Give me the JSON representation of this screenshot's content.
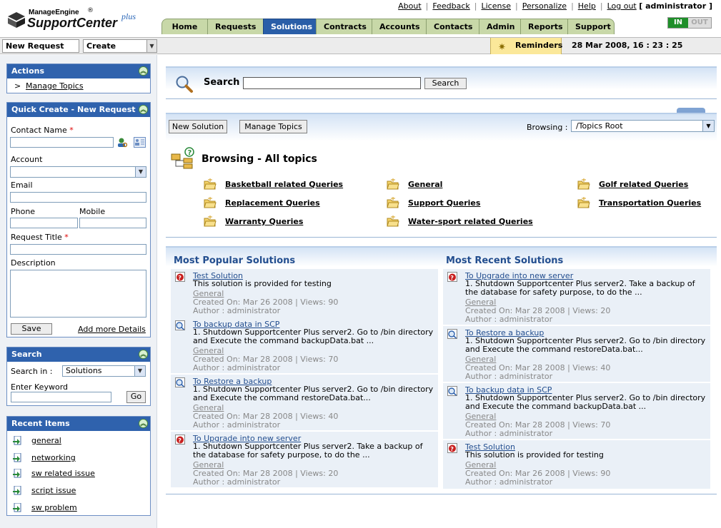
{
  "header": {
    "brand_top": "ManageEngine",
    "brand_reg": "®",
    "brand_name": "SupportCenter",
    "brand_plus": "plus",
    "links": [
      "About",
      "Feedback",
      "License",
      "Personalize",
      "Help",
      "Log out"
    ],
    "user": "[ administrator ]",
    "tabs": [
      "Home",
      "Requests",
      "Solutions",
      "Contracts",
      "Accounts",
      "Contacts",
      "Admin",
      "Reports",
      "Support"
    ],
    "active_tab": "Solutions",
    "in_label": "IN",
    "out_label": "OUT"
  },
  "toolbar": {
    "new_request": "New Request",
    "create": "Create",
    "reminders": "Reminders",
    "datetime": "28 Mar 2008, 16 : 23 : 25"
  },
  "sidebar": {
    "actions": {
      "title": "Actions",
      "bullet": ">",
      "manage_topics": "Manage Topics"
    },
    "quick_create": {
      "title": "Quick Create - New Request",
      "contact_name": "Contact Name",
      "required_mark": "*",
      "account": "Account",
      "email": "Email",
      "phone": "Phone",
      "mobile": "Mobile",
      "request_title": "Request Title",
      "description": "Description",
      "save": "Save",
      "add_more": "Add more Details"
    },
    "search": {
      "title": "Search",
      "search_in": "Search in :",
      "search_in_value": "Solutions",
      "enter_keyword": "Enter Keyword",
      "go": "Go"
    },
    "recent": {
      "title": "Recent Items",
      "items": [
        "general",
        "networking",
        "sw related issue",
        "script issue",
        "sw problem"
      ]
    }
  },
  "main": {
    "search_title": "Search",
    "search_button": "Search",
    "new_solution": "New Solution",
    "manage_topics": "Manage Topics",
    "browsing_label": "Browsing :",
    "browsing_value": "/Topics Root",
    "browse_title": "Browsing - All topics",
    "topics": [
      "Basketball related Queries",
      "General",
      "Golf related Queries",
      "Replacement Queries",
      "Support Queries",
      "Transportation Queries",
      "Warranty Queries",
      "Water-sport related Queries"
    ],
    "popular_title": "Most Popular Solutions",
    "recent_title": "Most Recent Solutions",
    "popular": [
      {
        "title": "Test Solution",
        "desc": "This solution is provided for testing",
        "cat": "General",
        "meta": "Created On: Mar 26 2008   |  Views: 90",
        "author": "Author : administrator",
        "icon": "red"
      },
      {
        "title": "To backup data in SCP",
        "desc": "1. Shutdown Supportcenter Plus server2. Go to /bin directory and Execute the command backupData.bat ...",
        "cat": "General",
        "meta": "Created On: Mar 28 2008   |  Views: 70",
        "author": "Author : administrator",
        "icon": "blue"
      },
      {
        "title": "To Restore a backup",
        "desc": "1. Shutdown Supportcenter Plus server2. Go to /bin directory and Execute the command restoreData.bat...",
        "cat": "General",
        "meta": "Created On: Mar 28 2008   |  Views: 40",
        "author": "Author : administrator",
        "icon": "blue"
      },
      {
        "title": "To Upgrade into new server",
        "desc": "1. Shutdown Supportcenter Plus server2. Take a backup of the database for safety purpose, to do the ...",
        "cat": "General",
        "meta": "Created On: Mar 28 2008   |  Views: 20",
        "author": "Author : administrator",
        "icon": "red"
      }
    ],
    "recent": [
      {
        "title": "To Upgrade into new server",
        "desc": "1. Shutdown Supportcenter Plus server2. Take a backup of the database for safety purpose, to do the ...",
        "cat": "General",
        "meta": "Created On: Mar 28 2008   |  Views: 20",
        "author": "Author : administrator",
        "icon": "red"
      },
      {
        "title": "To Restore a backup",
        "desc": "1. Shutdown Supportcenter Plus server2. Go to /bin directory and Execute the command restoreData.bat...",
        "cat": "General",
        "meta": "Created On: Mar 28 2008   |  Views: 40",
        "author": "Author : administrator",
        "icon": "blue"
      },
      {
        "title": "To backup data in SCP",
        "desc": "1. Shutdown Supportcenter Plus server2. Go to /bin directory and Execute the command backupData.bat ...",
        "cat": "General",
        "meta": "Created On: Mar 28 2008   |  Views: 70",
        "author": "Author : administrator",
        "icon": "blue"
      },
      {
        "title": "Test Solution",
        "desc": "This solution is provided for testing",
        "cat": "General",
        "meta": "Created On: Mar 26 2008   |  Views:  90",
        "author": "Author : administrator",
        "icon": "red"
      }
    ]
  },
  "colors": {
    "accent": "#2f62ad",
    "tab": "#c8d8a8",
    "link": "#234e8f",
    "reminder": "#fbe89a"
  }
}
